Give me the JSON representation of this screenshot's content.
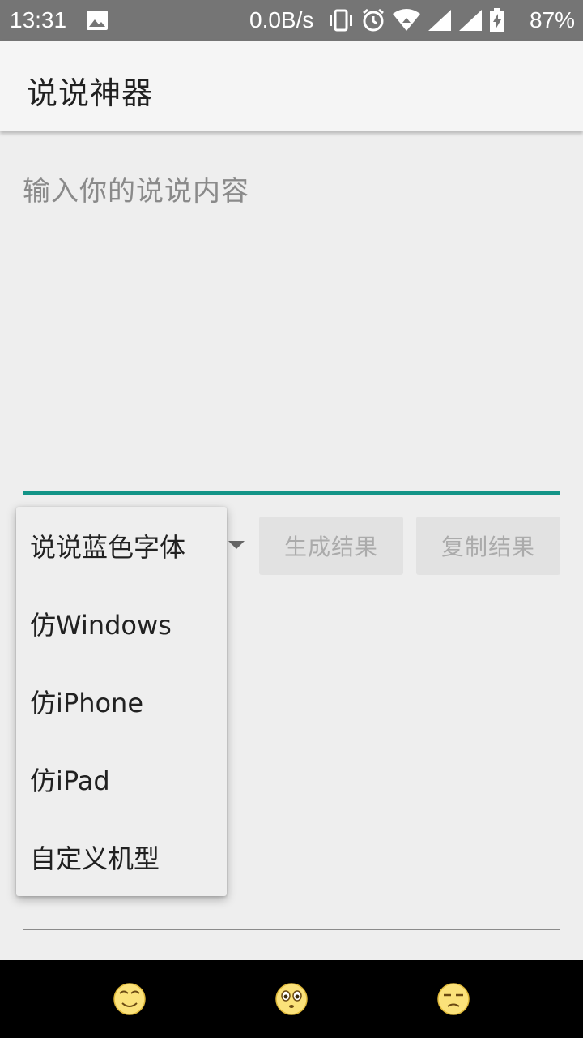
{
  "status_bar": {
    "time": "13:31",
    "net_speed": "0.0B/s",
    "battery_percent": "87%",
    "icons": [
      "image-icon",
      "vibrate-icon",
      "alarm-icon",
      "wifi-icon",
      "signal-icon",
      "signal-icon",
      "battery-charging-icon"
    ]
  },
  "app_bar": {
    "title": "说说神器"
  },
  "content": {
    "placeholder": "输入你的说说内容",
    "value": ""
  },
  "controls": {
    "generate_label": "生成结果",
    "copy_label": "复制结果"
  },
  "dropdown": {
    "options": [
      "说说蓝色字体",
      "仿Windows",
      "仿iPhone",
      "仿iPad",
      "自定义机型"
    ]
  },
  "bottom_bar": {
    "emojis": [
      "smiling-face-icon",
      "wide-eyed-face-icon",
      "annoyed-face-icon"
    ]
  },
  "colors": {
    "accent": "#139487",
    "status_bar": "#757575",
    "background": "#eeeeee",
    "bottom_bar": "#000000"
  }
}
